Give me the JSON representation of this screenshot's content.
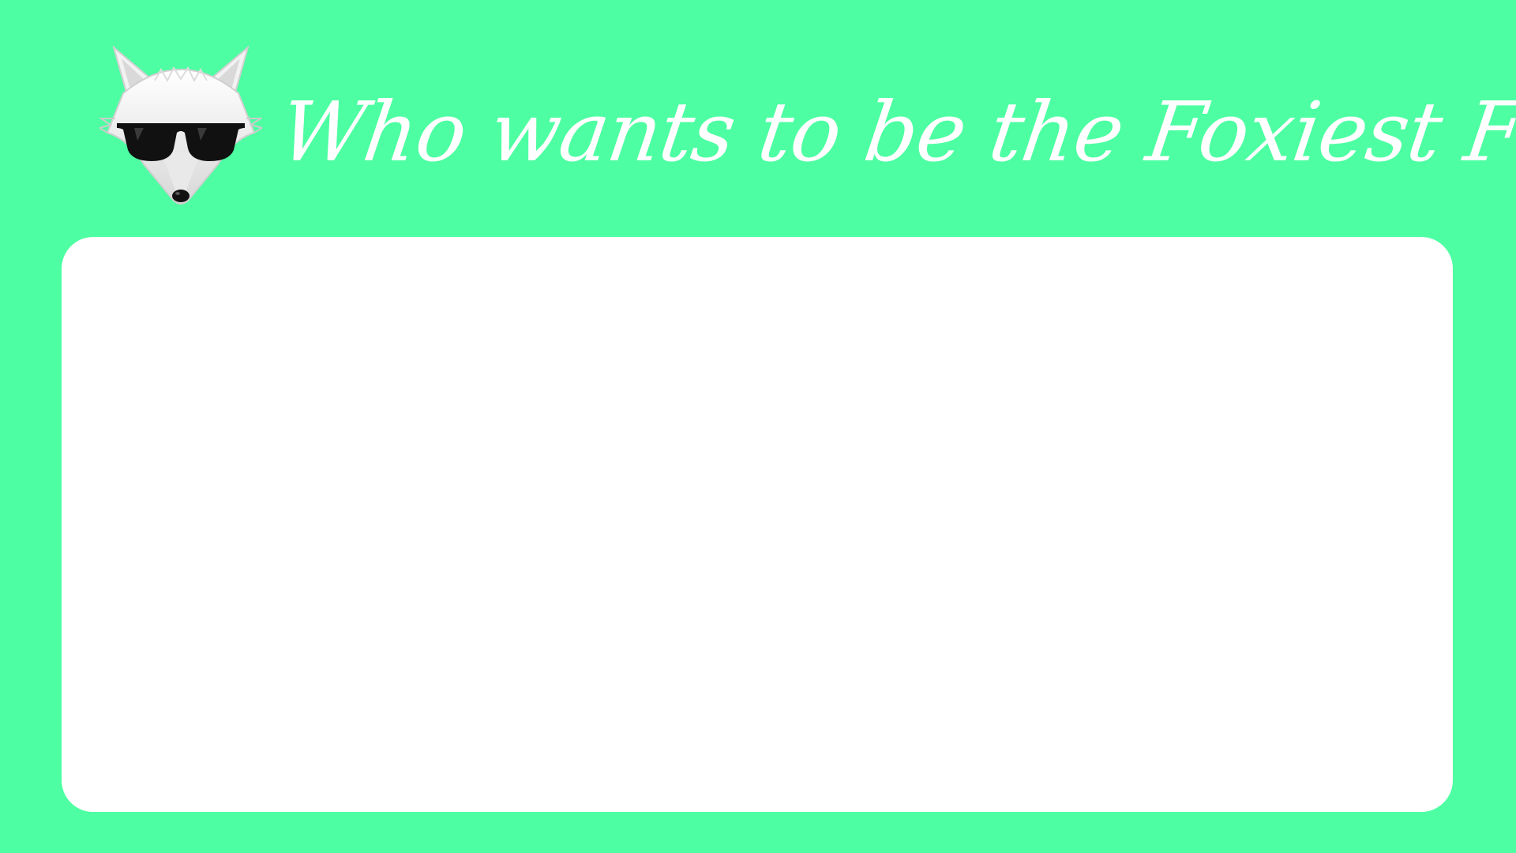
{
  "colors": {
    "background": "#4dffa2",
    "panel": "#ffffff",
    "title_text": "#ffffff"
  },
  "header": {
    "logo_icon": "fox-with-sunglasses-icon",
    "title": "Who wants to be the Foxiest Fox?"
  },
  "main": {
    "panel": {
      "content": ""
    }
  }
}
